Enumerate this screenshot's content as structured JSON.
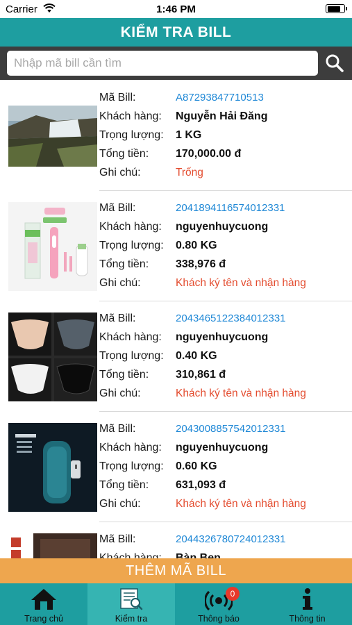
{
  "status_bar": {
    "carrier": "Carrier",
    "time": "1:46 PM",
    "battery_level": 0.85
  },
  "header": {
    "title": "KIỂM TRA BILL"
  },
  "search": {
    "placeholder": "Nhập mã bill cần tìm",
    "value": "",
    "icon": "search-icon"
  },
  "labels": {
    "bill": "Mã Bill:",
    "customer": "Khách hàng:",
    "weight": "Trọng lượng:",
    "total": "Tổng tiền:",
    "note": "Ghi chú:"
  },
  "bills": [
    {
      "image": "waterfall-landscape",
      "bill_id": "A87293847710513",
      "customer": "Nguyễn Hải Đăng",
      "weight": "1 KG",
      "total": "170,000.00 đ",
      "note": "Trống"
    },
    {
      "image": "electric-toothbrush",
      "bill_id": "2041894116574012331",
      "customer": "nguyenhuycuong",
      "weight": "0.80 KG",
      "total": "338,976 đ",
      "note": "Khách ký tên và nhận hàng"
    },
    {
      "image": "underwear-set",
      "bill_id": "2043465122384012331",
      "customer": "nguyenhuycuong",
      "weight": "0.40 KG",
      "total": "310,861 đ",
      "note": "Khách ký tên và nhận hàng"
    },
    {
      "image": "air-purifier",
      "bill_id": "2043008857542012331",
      "customer": "nguyenhuycuong",
      "weight": "0.60 KG",
      "total": "631,093 đ",
      "note": "Khách ký tên và nhận hàng"
    },
    {
      "image": "leather-bag",
      "bill_id": "2044326780724012331",
      "customer": "Bàn Ben",
      "weight": "",
      "total": "",
      "note": ""
    }
  ],
  "add_button": {
    "label": "THÊM MÃ BILL"
  },
  "tabs": [
    {
      "label": "Trang chủ",
      "icon": "home-icon"
    },
    {
      "label": "Kiểm tra",
      "icon": "bill-check-icon",
      "active": true
    },
    {
      "label": "Thông báo",
      "icon": "notification-icon",
      "badge": "0"
    },
    {
      "label": "Thông tin",
      "icon": "info-icon"
    }
  ],
  "colors": {
    "primary": "#1e9ea0",
    "active_tab": "#36b4b2",
    "search_bg": "#3d3d3d",
    "accent": "#eea64e",
    "bill_id": "#1f88d6",
    "note": "#e34b2e",
    "badge": "#e8392b"
  }
}
